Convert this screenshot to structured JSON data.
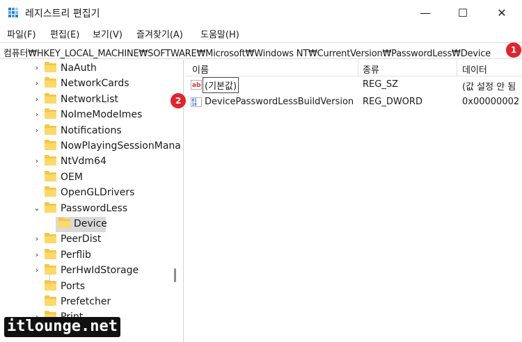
{
  "window": {
    "title": "레지스트리 편집기",
    "controls": {
      "minimize": "—",
      "maximize": "☐",
      "close": "✕"
    }
  },
  "menu": [
    "파일(F)",
    "편집(E)",
    "보기(V)",
    "즐겨찾기(A)",
    "도움말(H)"
  ],
  "address": {
    "path": "컴퓨터₩HKEY_LOCAL_MACHINE₩SOFTWARE₩Microsoft₩Windows NT₩CurrentVersion₩PasswordLess₩Device"
  },
  "badges": [
    "1",
    "2"
  ],
  "tree": {
    "items": [
      {
        "label": "NaAuth",
        "expander": "›"
      },
      {
        "label": "NetworkCards",
        "expander": "›"
      },
      {
        "label": "NetworkList",
        "expander": "›"
      },
      {
        "label": "NoImeModeImes",
        "expander": "›"
      },
      {
        "label": "Notifications",
        "expander": "›"
      },
      {
        "label": "NowPlayingSessionMana",
        "expander": ""
      },
      {
        "label": "NtVdm64",
        "expander": "›"
      },
      {
        "label": "OEM",
        "expander": ""
      },
      {
        "label": "OpenGLDrivers",
        "expander": ""
      },
      {
        "label": "PasswordLess",
        "expander": "⌄"
      },
      {
        "label": "Device",
        "expander": "",
        "selected": true
      },
      {
        "label": "PeerDist",
        "expander": "›"
      },
      {
        "label": "Perflib",
        "expander": "›"
      },
      {
        "label": "PerHwIdStorage",
        "expander": "›"
      },
      {
        "label": "Ports",
        "expander": ""
      },
      {
        "label": "Prefetcher",
        "expander": ""
      },
      {
        "label": "Print",
        "expander": "›"
      }
    ]
  },
  "list": {
    "columns": [
      "이름",
      "종류",
      "데이터"
    ],
    "rows": [
      {
        "name": "(기본값)",
        "type": "REG_SZ",
        "data": "(값 설정 안 됨",
        "icon": "string-value-icon"
      },
      {
        "name": "DevicePasswordLessBuildVersion",
        "type": "REG_DWORD",
        "data": "0x00000002",
        "icon": "dword-value-icon"
      }
    ]
  },
  "watermark": "itlounge.net",
  "colors": {
    "badge": "#e3232b",
    "folder": "#f6c744",
    "selection": "#d9d9d9"
  }
}
